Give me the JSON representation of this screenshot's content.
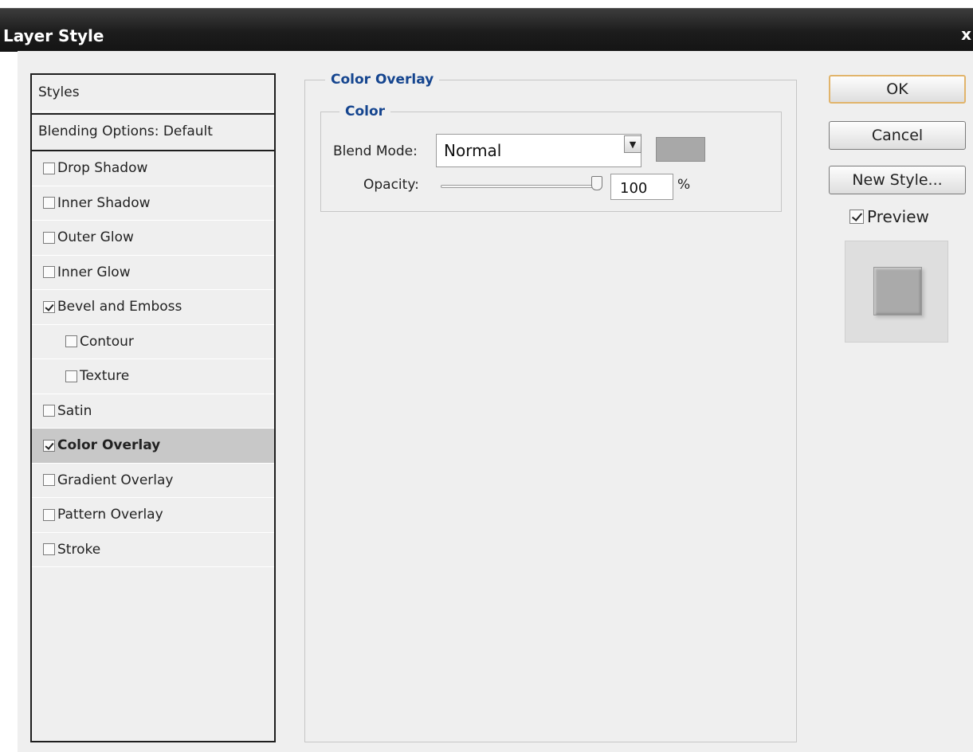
{
  "window": {
    "title": "Layer Style",
    "close_label": "x"
  },
  "styles_panel": {
    "header": "Styles",
    "blending_options": "Blending Options: Default",
    "items": [
      {
        "label": "Drop Shadow",
        "checked": false
      },
      {
        "label": "Inner Shadow",
        "checked": false
      },
      {
        "label": "Outer Glow",
        "checked": false
      },
      {
        "label": "Inner Glow",
        "checked": false
      },
      {
        "label": "Bevel and Emboss",
        "checked": true
      },
      {
        "label": "Contour",
        "checked": false
      },
      {
        "label": "Texture",
        "checked": false
      },
      {
        "label": "Satin",
        "checked": false
      },
      {
        "label": "Color Overlay",
        "checked": true,
        "selected": true
      },
      {
        "label": "Gradient Overlay",
        "checked": false
      },
      {
        "label": "Pattern Overlay",
        "checked": false
      },
      {
        "label": "Stroke",
        "checked": false
      }
    ]
  },
  "color_overlay": {
    "title": "Color Overlay",
    "group_title": "Color",
    "blend_mode_label": "Blend Mode:",
    "blend_mode_value": "Normal",
    "swatch_color": "#a8a8a8",
    "opacity_label": "Opacity:",
    "opacity_value": "100",
    "opacity_unit": "%"
  },
  "buttons": {
    "ok": "OK",
    "cancel": "Cancel",
    "new_style": "New Style..."
  },
  "preview": {
    "label": "Preview",
    "checked": true
  }
}
